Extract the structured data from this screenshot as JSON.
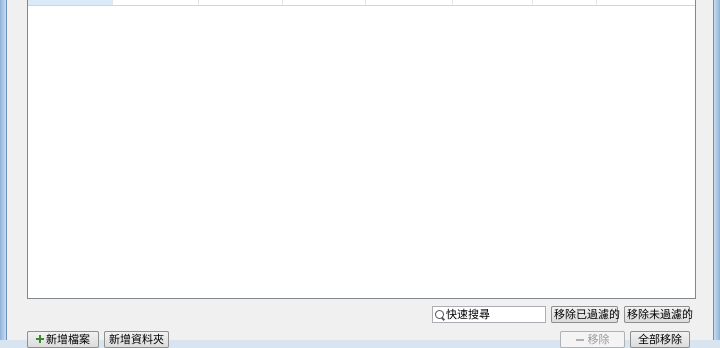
{
  "list": {
    "columns": [
      "",
      "",
      "",
      "",
      "",
      "",
      "",
      ""
    ]
  },
  "filter": {
    "search_placeholder": "快速搜尋",
    "remove_filtered_label": "移除已過濾的",
    "remove_unfiltered_label": "移除未過濾的"
  },
  "actions": {
    "add_file_label": "新增檔案",
    "add_folder_label": "新增資料夾",
    "remove_label": "移除",
    "remove_all_label": "全部移除"
  }
}
